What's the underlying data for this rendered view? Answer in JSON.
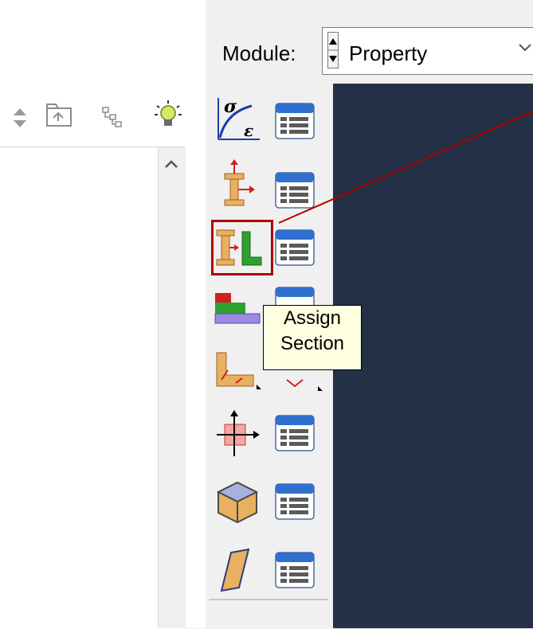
{
  "module_bar": {
    "label": "Module:",
    "selected": "Property"
  },
  "tooltip": {
    "line1": "Assign",
    "line2": "Section"
  },
  "colors": {
    "viewport_bg": "#233045",
    "highlight": "#b00000",
    "tooltip_bg": "#ffffe1"
  },
  "toolbox": {
    "tools": [
      {
        "icon": "create-material-icon"
      },
      {
        "icon": "create-section-icon"
      },
      {
        "icon": "assign-section-icon"
      },
      {
        "icon": "create-profile-icon"
      },
      {
        "icon": "assign-beam-orientation-icon"
      },
      {
        "icon": "assign-material-orientation-icon"
      },
      {
        "icon": "create-skin-icon"
      },
      {
        "icon": "create-stringer-icon"
      }
    ]
  }
}
